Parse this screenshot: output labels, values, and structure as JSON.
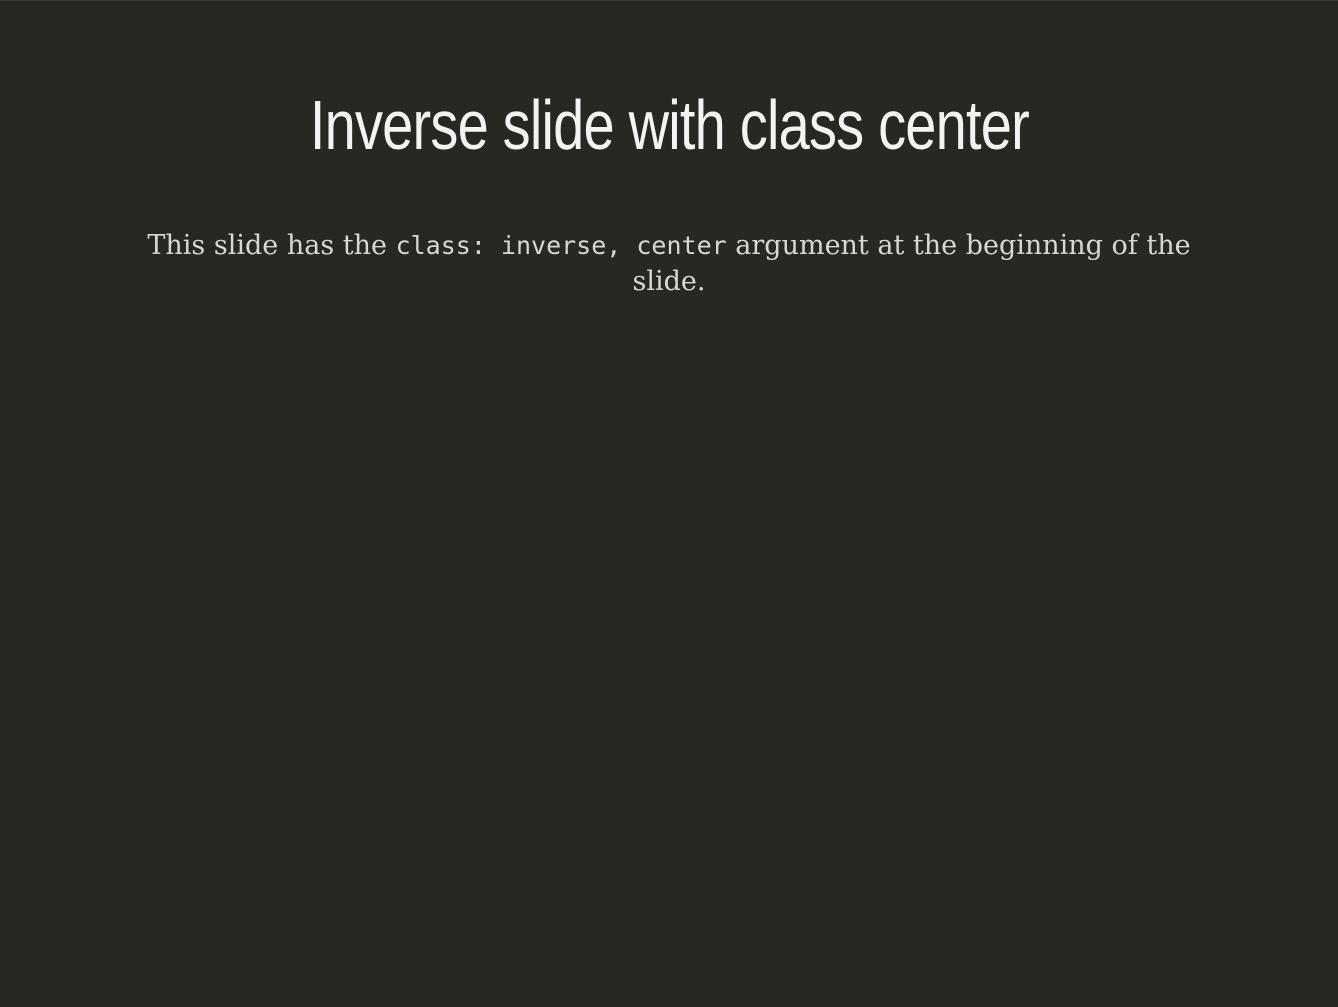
{
  "slide": {
    "title": "Inverse slide with class center",
    "body": {
      "text_before": "This slide has the ",
      "code": "class: inverse, center",
      "text_after": " argument at the beginning of the slide."
    },
    "colors": {
      "background": "#272822",
      "title": "#f3f3f3",
      "body": "#d8d8d2"
    }
  }
}
